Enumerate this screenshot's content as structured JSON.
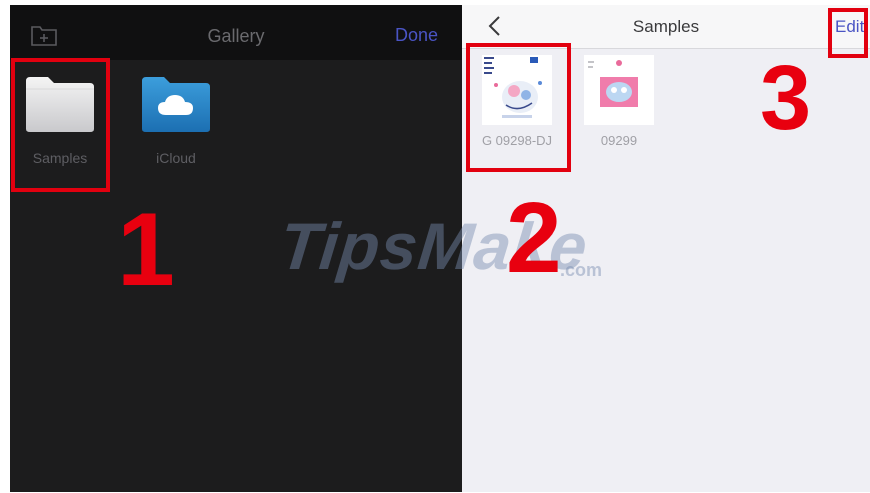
{
  "left_panel": {
    "title": "Gallery",
    "done_label": "Done",
    "new_folder_icon": "folder-plus-icon",
    "folders": [
      {
        "label": "Samples",
        "icon": "folder-icon"
      },
      {
        "label": "iCloud",
        "icon": "icloud-folder-icon"
      }
    ]
  },
  "right_panel": {
    "title": "Samples",
    "edit_label": "Edit",
    "back_icon": "chevron-left-icon",
    "files": [
      {
        "label": "G 09298-DJ"
      },
      {
        "label": "09299"
      }
    ]
  },
  "annotations": {
    "steps": [
      "1",
      "2",
      "3"
    ],
    "color": "#e2000f"
  },
  "watermark": {
    "text": "TipsMake",
    "suffix": ".com"
  },
  "colors": {
    "dark_bg": "#1c1c1d",
    "light_bg": "#efeff4",
    "accent": "#4a54c4"
  }
}
